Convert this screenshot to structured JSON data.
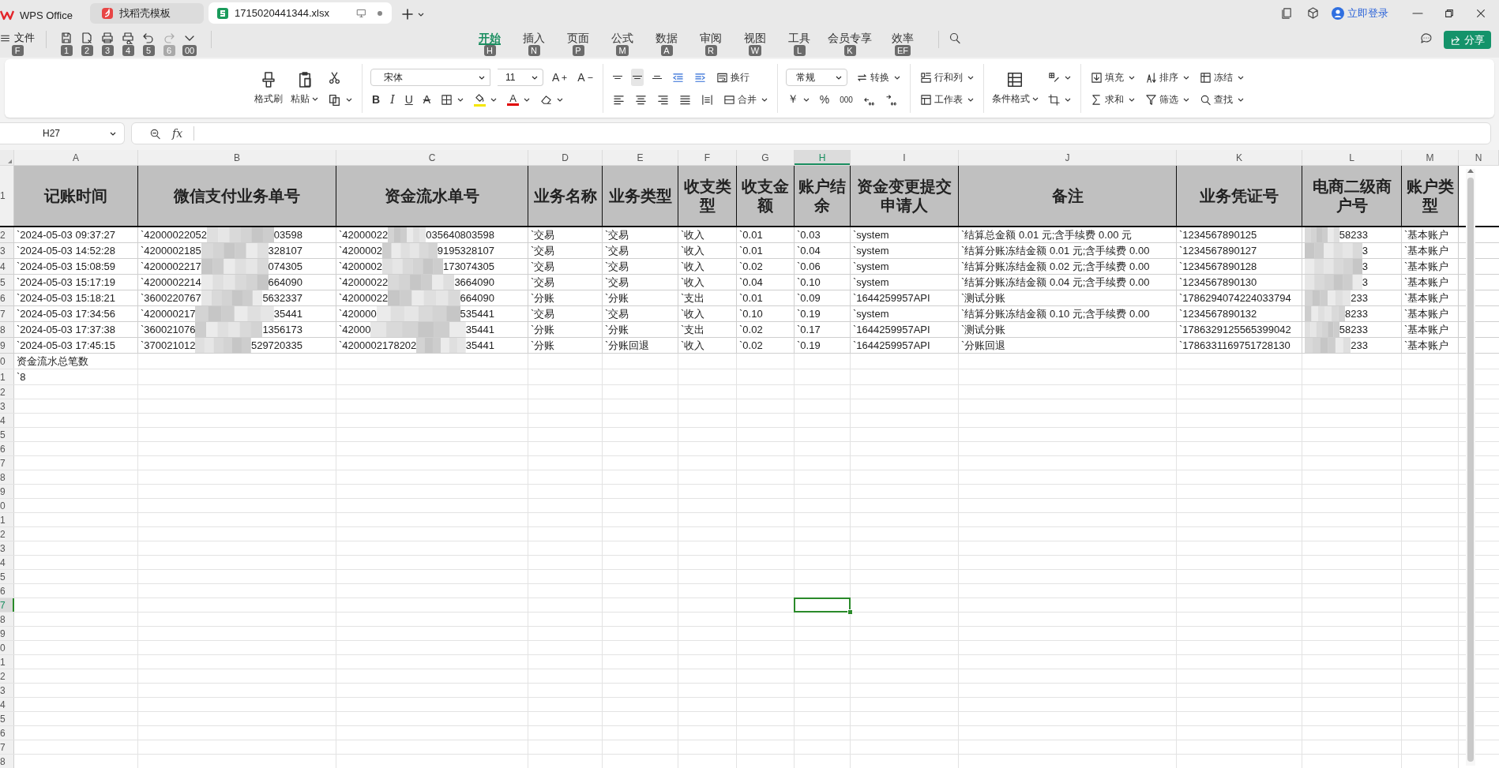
{
  "tabs": [
    {
      "label": "WPS Office",
      "selected": false,
      "kind": "home"
    },
    {
      "label": "找稻壳模板",
      "selected": false,
      "kind": "templates"
    },
    {
      "label": "1715020441344.xlsx",
      "selected": true,
      "kind": "sheet"
    }
  ],
  "account": {
    "login": "立即登录"
  },
  "file_menu": {
    "label": "文件",
    "key": "F"
  },
  "quick_access": [
    {
      "key": "1",
      "disabled": false
    },
    {
      "key": "2",
      "disabled": false
    },
    {
      "key": "3",
      "disabled": false
    },
    {
      "key": "4",
      "disabled": false
    },
    {
      "key": "5",
      "disabled": false
    },
    {
      "key": "6",
      "disabled": true
    },
    {
      "key": "00",
      "disabled": false
    }
  ],
  "menu": [
    {
      "label": "开始",
      "key": "H",
      "selected": true
    },
    {
      "label": "插入",
      "key": "N",
      "selected": false
    },
    {
      "label": "页面",
      "key": "P",
      "selected": false
    },
    {
      "label": "公式",
      "key": "M",
      "selected": false
    },
    {
      "label": "数据",
      "key": "A",
      "selected": false
    },
    {
      "label": "审阅",
      "key": "R",
      "selected": false
    },
    {
      "label": "视图",
      "key": "W",
      "selected": false
    },
    {
      "label": "工具",
      "key": "L",
      "selected": false
    },
    {
      "label": "会员专享",
      "key": "K",
      "selected": false
    },
    {
      "label": "效率",
      "key": "EF",
      "selected": false
    }
  ],
  "share": "分享",
  "ribbon": {
    "format_painter": "格式刷",
    "paste": "粘贴",
    "font": "宋体",
    "size": "11",
    "grow": "A",
    "shrink": "A",
    "bold": "B",
    "italic": "I",
    "underline": "U",
    "strike": "A",
    "font_color": "A",
    "wrap": "换行",
    "merge": "合并",
    "number_format": "常规",
    "convert": "转换",
    "currency": "￥",
    "percent": "%",
    "thousands": "000",
    "rows_cols": "行和列",
    "worksheet": "工作表",
    "conditional": "条件格式",
    "fill": "填充",
    "sort": "排序",
    "freeze": "冻结",
    "sum": "求和",
    "filter": "筛选",
    "find": "查找"
  },
  "formula_bar": {
    "cell_name": "H27",
    "function_label": "fx"
  },
  "sheet": {
    "columns": [
      {
        "label": "A",
        "selected": false
      },
      {
        "label": "B",
        "selected": false
      },
      {
        "label": "C",
        "selected": false
      },
      {
        "label": "D",
        "selected": false
      },
      {
        "label": "E",
        "selected": false
      },
      {
        "label": "F",
        "selected": false
      },
      {
        "label": "G",
        "selected": false
      },
      {
        "label": "H",
        "selected": true
      },
      {
        "label": "I",
        "selected": false
      },
      {
        "label": "J",
        "selected": false
      },
      {
        "label": "K",
        "selected": false
      },
      {
        "label": "L",
        "selected": false
      },
      {
        "label": "M",
        "selected": false
      },
      {
        "label": "N",
        "selected": false
      }
    ],
    "rows": [
      {
        "number": "1",
        "selected": false,
        "kind": "header",
        "cells": [
          "记账时间",
          "微信支付业务单号",
          "资金流水单号",
          "业务名称",
          "业务类型",
          "收支类型",
          "收支金额",
          "账户结余",
          "资金变更提交申请人",
          "备注",
          "业务凭证号",
          "电商二级商户号",
          "账户类型"
        ]
      },
      {
        "number": "2",
        "selected": false,
        "kind": "data",
        "cells": [
          "`2024-05-03 09:37:27",
          {
            "start": "`42000022052",
            "end": "03598"
          },
          {
            "start": "`42000022",
            "end": "035640803598"
          },
          "`交易",
          "`交易",
          "`收入",
          "`0.01",
          "`0.03",
          "`system",
          "`结算总金额 0.01 元;含手续费 0.00 元",
          "`1234567890125",
          {
            "end": "58233"
          },
          "`基本账户"
        ]
      },
      {
        "number": "3",
        "selected": false,
        "kind": "data",
        "cells": [
          "`2024-05-03 14:52:28",
          {
            "start": "`4200002185",
            "end": "328107"
          },
          {
            "start": "`4200002",
            "end": "9195328107"
          },
          "`交易",
          "`交易",
          "`收入",
          "`0.01",
          "`0.04",
          "`system",
          "`结算分账冻结金额 0.01 元;含手续费 0.00",
          "`1234567890127",
          {
            "end": "3"
          },
          "`基本账户"
        ]
      },
      {
        "number": "4",
        "selected": false,
        "kind": "data",
        "cells": [
          "`2024-05-03 15:08:59",
          {
            "start": "`4200002217",
            "end": "074305"
          },
          {
            "start": "`4200002",
            "end": "173074305"
          },
          "`交易",
          "`交易",
          "`收入",
          "`0.02",
          "`0.06",
          "`system",
          "`结算分账冻结金额 0.02 元;含手续费 0.00",
          "`1234567890128",
          {
            "end": "3"
          },
          "`基本账户"
        ]
      },
      {
        "number": "5",
        "selected": false,
        "kind": "data",
        "cells": [
          "`2024-05-03 15:17:19",
          {
            "start": "`4200002214",
            "end": "664090"
          },
          {
            "start": "`42000022",
            "end": "3664090"
          },
          "`交易",
          "`交易",
          "`收入",
          "`0.04",
          "`0.10",
          "`system",
          "`结算分账冻结金额 0.04 元;含手续费 0.00",
          "`1234567890130",
          {
            "end": "3"
          },
          "`基本账户"
        ]
      },
      {
        "number": "6",
        "selected": false,
        "kind": "data",
        "cells": [
          "`2024-05-03 15:18:21",
          {
            "start": "`3600220767",
            "end": "5632337"
          },
          {
            "start": "`42000022",
            "end": "664090"
          },
          "`分账",
          "`分账",
          "`支出",
          "`0.01",
          "`0.09",
          "`1644259957API",
          "`测试分账",
          "`1786294074224033794",
          {
            "end": "233"
          },
          "`基本账户"
        ]
      },
      {
        "number": "7",
        "selected": false,
        "kind": "data",
        "cells": [
          "`2024-05-03 17:34:56",
          {
            "start": "`420000217",
            "end": "35441"
          },
          {
            "start": "`420000",
            "end": "535441"
          },
          "`交易",
          "`交易",
          "`收入",
          "`0.10",
          "`0.19",
          "`system",
          "`结算分账冻结金额 0.10 元;含手续费 0.00",
          "`1234567890132",
          {
            "end": "8233"
          },
          "`基本账户"
        ]
      },
      {
        "number": "8",
        "selected": false,
        "kind": "data",
        "cells": [
          "`2024-05-03 17:37:38",
          {
            "start": "`360021076",
            "end": "1356173"
          },
          {
            "start": "`42000",
            "end": "35441"
          },
          "`分账",
          "`分账",
          "`支出",
          "`0.02",
          "`0.17",
          "`1644259957API",
          "`测试分账",
          "`1786329125565399042",
          {
            "end": "58233"
          },
          "`基本账户"
        ]
      },
      {
        "number": "9",
        "selected": false,
        "kind": "data",
        "cells": [
          "`2024-05-03 17:45:15",
          {
            "start": "`370021012",
            "end": "529720335"
          },
          {
            "start": "`4200002178202",
            "end": "35441"
          },
          "`分账",
          "`分账回退",
          "`收入",
          "`0.02",
          "`0.19",
          "`1644259957API",
          "`分账回退",
          "`1786331169751728130",
          {
            "end": "233"
          },
          "`基本账户"
        ]
      },
      {
        "number": "0",
        "selected": false,
        "kind": "plain",
        "cells": [
          "资金流水总笔数"
        ]
      },
      {
        "number": "1",
        "selected": false,
        "kind": "plain",
        "cells": [
          "`8"
        ]
      },
      {
        "number": "2",
        "selected": false
      },
      {
        "number": "3",
        "selected": false
      },
      {
        "number": "4",
        "selected": false
      },
      {
        "number": "5",
        "selected": false
      },
      {
        "number": "6",
        "selected": false
      },
      {
        "number": "7",
        "selected": false
      },
      {
        "number": "8",
        "selected": false
      },
      {
        "number": "9",
        "selected": false
      },
      {
        "number": "0",
        "selected": false
      },
      {
        "number": "1",
        "selected": false
      },
      {
        "number": "2",
        "selected": false
      },
      {
        "number": "3",
        "selected": false
      },
      {
        "number": "4",
        "selected": false
      },
      {
        "number": "5",
        "selected": false
      },
      {
        "number": "6",
        "selected": false
      },
      {
        "number": "7",
        "selected": true
      },
      {
        "number": "8",
        "selected": false
      },
      {
        "number": "9",
        "selected": false
      },
      {
        "number": "0",
        "selected": false
      },
      {
        "number": "1",
        "selected": false
      },
      {
        "number": "2",
        "selected": false
      },
      {
        "number": "3",
        "selected": false
      },
      {
        "number": "4",
        "selected": false
      },
      {
        "number": "5",
        "selected": false
      },
      {
        "number": "6",
        "selected": false
      },
      {
        "number": "7",
        "selected": false
      },
      {
        "number": "8",
        "selected": false
      }
    ]
  }
}
